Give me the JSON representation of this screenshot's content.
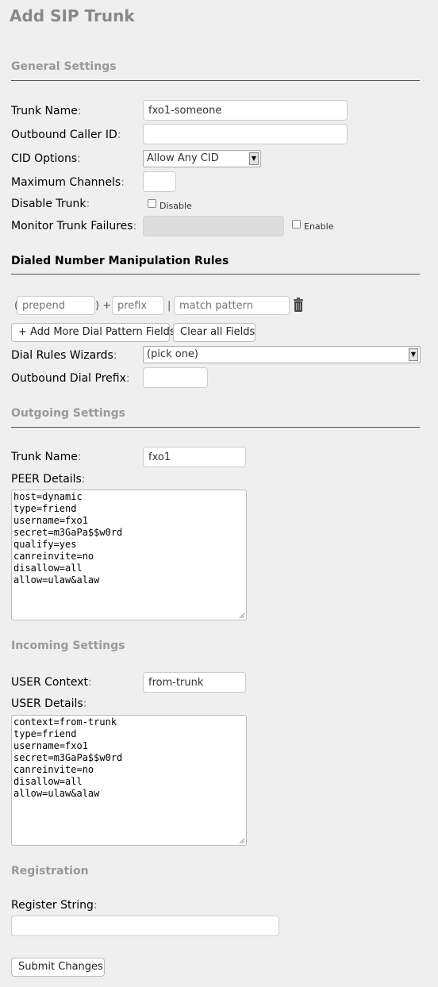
{
  "page": {
    "title": "Add SIP Trunk"
  },
  "general": {
    "heading": "General Settings",
    "trunk_name_label": "Trunk Name",
    "trunk_name_value": "fxo1-someone",
    "outbound_cid_label": "Outbound Caller ID",
    "outbound_cid_value": "",
    "cid_options_label": "CID Options",
    "cid_options_value": "Allow Any CID",
    "max_channels_label": "Maximum Channels",
    "max_channels_value": "",
    "disable_trunk_label": "Disable Trunk",
    "disable_checkbox_label": "Disable",
    "monitor_failures_label": "Monitor Trunk Failures",
    "monitor_failures_value": "",
    "enable_checkbox_label": "Enable",
    "colon": ":"
  },
  "dial_rules": {
    "heading": "Dialed Number Manipulation Rules",
    "open_paren": "(",
    "close_plus": ") +",
    "pipe": "|",
    "prepend_placeholder": "prepend",
    "prefix_placeholder": "prefix",
    "match_pattern_placeholder": "match pattern",
    "add_more_button": "+ Add More Dial Pattern Fields",
    "clear_all_button": "Clear all Fields",
    "wizards_label": "Dial Rules Wizards",
    "wizards_value": "(pick one)",
    "outbound_prefix_label": "Outbound Dial Prefix",
    "outbound_prefix_value": ""
  },
  "outgoing": {
    "heading": "Outgoing Settings",
    "trunk_name_label": "Trunk Name",
    "trunk_name_value": "fxo1",
    "peer_details_label": "PEER Details",
    "peer_details_value": "host=dynamic\ntype=friend\nusername=fxo1\nsecret=m3GaPa$$w0rd\nqualify=yes\ncanreinvite=no\ndisallow=all\nallow=ulaw&alaw"
  },
  "incoming": {
    "heading": "Incoming Settings",
    "user_context_label": "USER Context",
    "user_context_value": "from-trunk",
    "user_details_label": "USER Details",
    "user_details_value": "context=from-trunk\ntype=friend\nusername=fxo1\nsecret=m3GaPa$$w0rd\ncanreinvite=no\ndisallow=all\nallow=ulaw&alaw"
  },
  "registration": {
    "heading": "Registration",
    "register_string_label": "Register String",
    "register_string_value": ""
  },
  "submit_label": "Submit Changes"
}
